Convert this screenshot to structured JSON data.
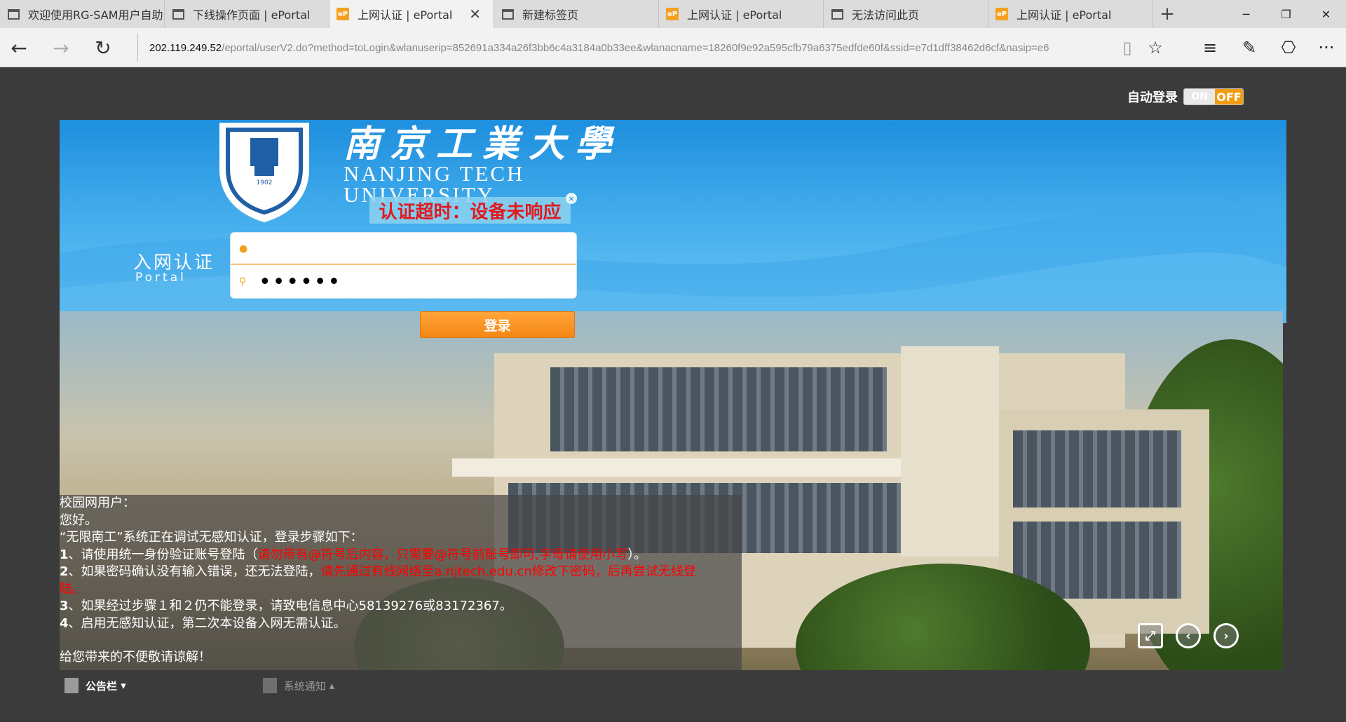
{
  "browser": {
    "tabs": [
      {
        "title": "欢迎使用RG-SAM用户自助",
        "favicon": "page-icon",
        "active": false
      },
      {
        "title": "下线操作页面 | ePortal",
        "favicon": "page-icon",
        "active": false
      },
      {
        "title": "上网认证 | ePortal",
        "favicon": "eportal-icon",
        "active": true
      },
      {
        "title": "新建标签页",
        "favicon": "page-icon",
        "active": false
      },
      {
        "title": "上网认证 | ePortal",
        "favicon": "eportal-icon",
        "active": false
      },
      {
        "title": "无法访问此页",
        "favicon": "page-icon",
        "active": false
      },
      {
        "title": "上网认证 | ePortal",
        "favicon": "eportal-icon",
        "active": false
      }
    ],
    "favicon_text": "eP",
    "newtab_glyph": "+",
    "window": {
      "minimize": "─",
      "maximize": "❐",
      "close": "✕"
    },
    "url_host": "202.119.249.52",
    "url_path": "/eportal/userV2.do?method=toLogin&wlanuserip=852691a334a26f3bb6c4a3184a0b33ee&wlanacname=18260f9e92a595cfb79a6375edfde60f&ssid=e7d1dff38462d6cf&nasip=e6",
    "nav": {
      "back": "←",
      "forward": "→",
      "refresh": "↻"
    },
    "tools": {
      "reading": "▯",
      "favorite": "☆",
      "hub": "≡",
      "note": "✎",
      "share": "⎔",
      "more": "···"
    }
  },
  "page": {
    "autologin_label": "自动登录",
    "toggle_on": "ON",
    "toggle_off": "OFF",
    "school_cn": "南京工業大學",
    "school_en": "NANJING TECH UNIVERSITY",
    "logo_year": "1902",
    "logo_ring": "NANJING TECH UNIVERSITY",
    "alert": "认证超时：设备未响应",
    "alert_close": "×",
    "portal_cn": "入网认证",
    "portal_en": "Portal",
    "username_value": "",
    "password_value": "••••••",
    "login_button": "登录",
    "notice": {
      "greeting1": "校园网用户：",
      "greeting2": "您好。",
      "intro": "“无限南工”系统正在调试无感知认证，登录步骤如下：",
      "steps": [
        {
          "num": "1",
          "text": "、请使用统一身份验证账号登陆（",
          "red": "请勿带有@符号后内容，只需要@符号前账号即可,字母请使用小写",
          "tail": "）。"
        },
        {
          "num": "2",
          "text": "、如果密码确认没有输入错误，还无法登陆，",
          "red": "请先通过有线网络至a.njtech.edu.cn修改下密码，后再尝试无线登陆。",
          "tail": ""
        },
        {
          "num": "3",
          "text": "、如果经过步骤１和２仍不能登录，请致电信息中心58139276或83172367。",
          "red": "",
          "tail": ""
        },
        {
          "num": "4",
          "text": "、启用无感知认证，第二次本设备入网无需认证。",
          "red": "",
          "tail": ""
        }
      ],
      "closing": "给您带来的不便敬请谅解！"
    },
    "controls": {
      "fullscreen": "⤢",
      "prev": "‹",
      "next": "›"
    },
    "footer": {
      "bulletin": "公告栏",
      "bulletin_arrow": "▾",
      "system_notice": "系统通知",
      "system_notice_arrow": "▴"
    },
    "colors": {
      "accent": "#f58715",
      "sky": "#2b9be3",
      "alert_text": "#e3191d"
    }
  }
}
